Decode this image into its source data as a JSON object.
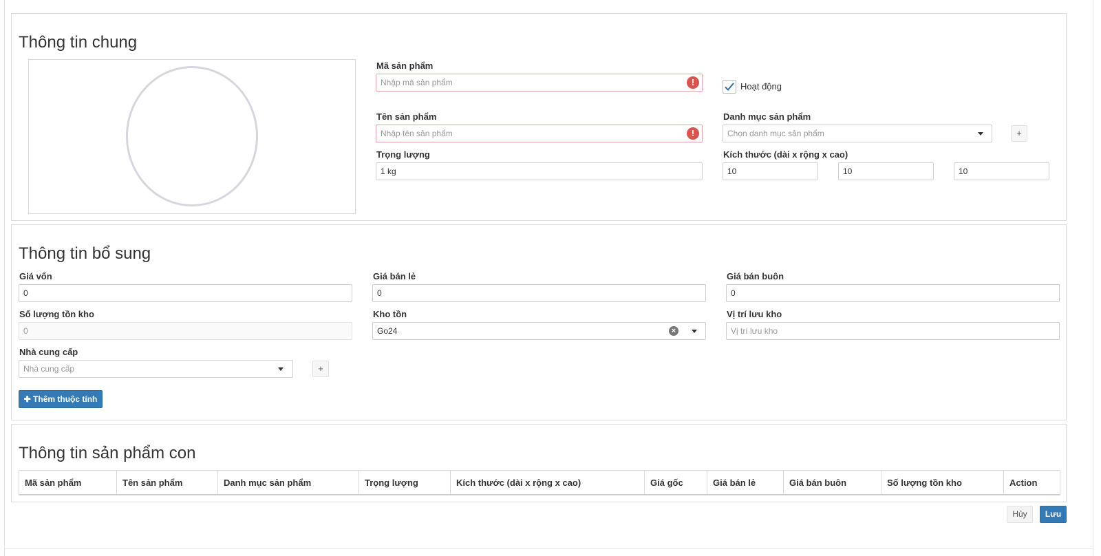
{
  "general": {
    "title": "Thông tin chung",
    "product_code": {
      "label": "Mã sản phẩm",
      "placeholder": "Nhập mã sản phẩm",
      "value": ""
    },
    "active": {
      "label": "Hoạt động",
      "checked": true
    },
    "product_name": {
      "label": "Tên sản phẩm",
      "placeholder": "Nhập tên sản phẩm",
      "value": ""
    },
    "category": {
      "label": "Danh mục sản phẩm",
      "placeholder": "Chọn danh mục sản phẩm",
      "add_label": "+"
    },
    "weight": {
      "label": "Trọng lượng",
      "value": "1 kg"
    },
    "dimensions": {
      "label": "Kích thước (dài x rộng x cao)",
      "length": "10",
      "width": "10",
      "height": "10"
    }
  },
  "extra": {
    "title": "Thông tin bổ sung",
    "cost_price": {
      "label": "Giá vốn",
      "value": "0"
    },
    "retail_price": {
      "label": "Giá bán lẻ",
      "value": "0"
    },
    "wholesale_price": {
      "label": "Giá bán buôn",
      "value": "0"
    },
    "stock_qty": {
      "label": "Số lượng tồn kho",
      "placeholder": "0"
    },
    "warehouse": {
      "label": "Kho tồn",
      "value": "Go24"
    },
    "storage_location": {
      "label": "Vị trí lưu kho",
      "placeholder": "Vị trí lưu kho"
    },
    "supplier": {
      "label": "Nhà cung cấp",
      "placeholder": "Nhà cung cấp",
      "add_label": "+"
    },
    "add_attribute_label": "✚ Thêm thuộc tính"
  },
  "variants": {
    "title": "Thông tin sản phẩm con",
    "columns": [
      "Mã sản phẩm",
      "Tên sản phẩm",
      "Danh mục sản phẩm",
      "Trọng lượng",
      "Kích thước (dài x rộng x cao)",
      "Giá gốc",
      "Giá bán lẻ",
      "Giá bán buôn",
      "Số lượng tồn kho",
      "Action"
    ]
  },
  "footer": {
    "cancel_label": "Hủy",
    "save_label": "Lưu"
  },
  "colors": {
    "primary": "#337ab7",
    "error": "#d9534f",
    "error_border": "#e8a0a0"
  },
  "icons": {
    "error": "exclamation-circle-icon",
    "check": "check-icon",
    "caret": "caret-down-icon",
    "clear": "times-circle-icon",
    "plus": "plus-icon"
  }
}
